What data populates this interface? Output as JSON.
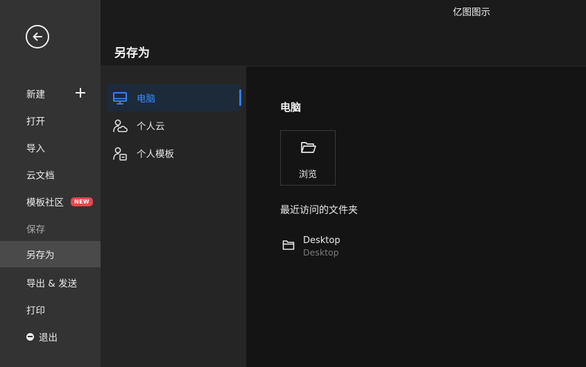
{
  "app": {
    "title": "亿图图示"
  },
  "page": {
    "title": "另存为"
  },
  "leftnav": {
    "items": [
      {
        "label": "新建"
      },
      {
        "label": "打开"
      },
      {
        "label": "导入"
      },
      {
        "label": "云文档"
      },
      {
        "label": "模板社区",
        "badge": "NEW"
      },
      {
        "label": "保存"
      },
      {
        "label": "另存为"
      },
      {
        "label": "导出 & 发送"
      },
      {
        "label": "打印"
      },
      {
        "label": "退出"
      }
    ]
  },
  "locations": {
    "items": [
      {
        "label": "电脑",
        "icon": "monitor-icon"
      },
      {
        "label": "个人云",
        "icon": "user-cloud-icon"
      },
      {
        "label": "个人模板",
        "icon": "user-template-icon"
      }
    ]
  },
  "content": {
    "section_title": "电脑",
    "browse_label": "浏览",
    "recent_title": "最近访问的文件夹",
    "recent": [
      {
        "name": "Desktop",
        "path": "Desktop"
      }
    ]
  },
  "colors": {
    "accent": "#2f7bff",
    "badge": "#e5484d",
    "sidebar": "#333333"
  }
}
